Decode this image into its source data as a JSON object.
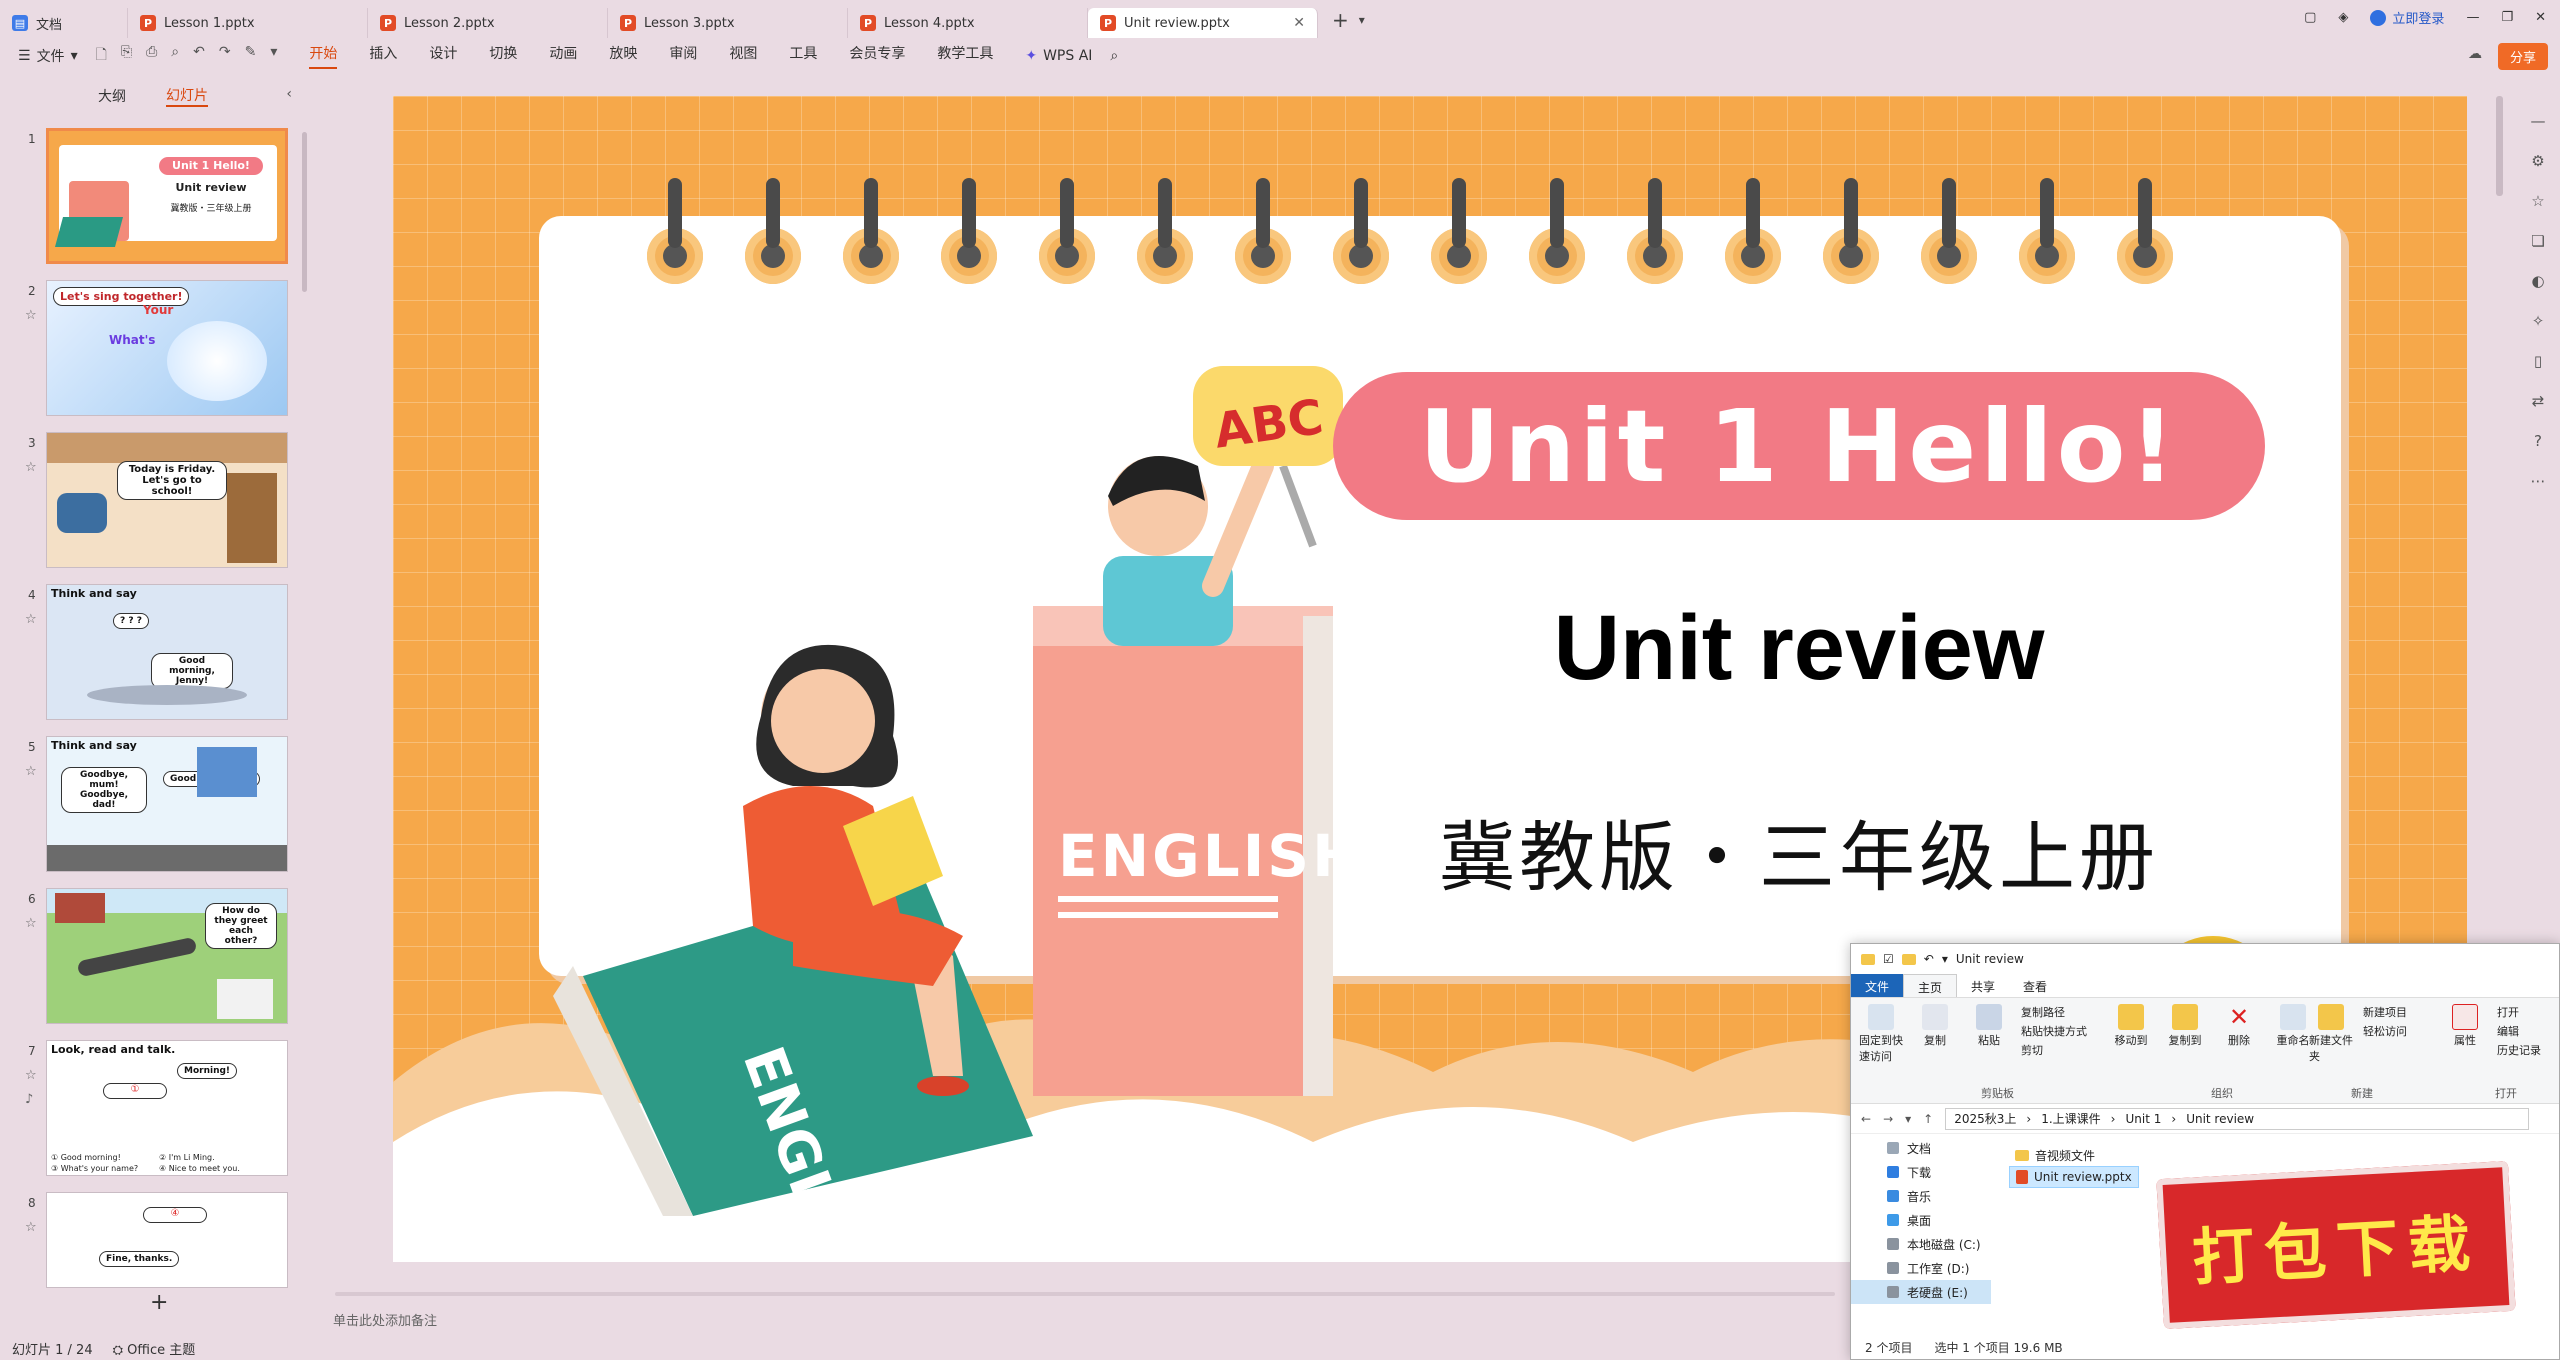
{
  "tabs": [
    {
      "label": "文档",
      "icon": "doc-icon",
      "kind": "d"
    },
    {
      "label": "Lesson 1.pptx",
      "icon": "ppt-icon",
      "kind": "p"
    },
    {
      "label": "Lesson 2.pptx",
      "icon": "ppt-icon",
      "kind": "p"
    },
    {
      "label": "Lesson 3.pptx",
      "icon": "ppt-icon",
      "kind": "p"
    },
    {
      "label": "Lesson 4.pptx",
      "icon": "ppt-icon",
      "kind": "p"
    },
    {
      "label": "Unit review.pptx",
      "icon": "ppt-icon",
      "kind": "p",
      "active": true
    }
  ],
  "topright": {
    "login": "立即登录"
  },
  "ribbon": {
    "file": "文件",
    "menu": [
      "开始",
      "插入",
      "设计",
      "切换",
      "动画",
      "放映",
      "审阅",
      "视图",
      "工具",
      "会员专享",
      "教学工具"
    ],
    "active": "开始",
    "wps_ai": "WPS AI",
    "share": "分享"
  },
  "leftpanel": {
    "tabs": [
      "大纲",
      "幻灯片"
    ],
    "active": "幻灯片",
    "slides": [
      {
        "num": "1",
        "title": "Unit 1 Hello!",
        "sub": "Unit review",
        "pub": "冀教版・三年级上册"
      },
      {
        "num": "2",
        "caption": "Let's sing together!",
        "words": [
          "Your",
          "What's"
        ]
      },
      {
        "num": "3",
        "caption": "Today is Friday. Let's go to school!"
      },
      {
        "num": "4",
        "header": "Think and say",
        "caption": "Good morning, Jenny!",
        "q": "? ? ?"
      },
      {
        "num": "5",
        "header": "Think and say",
        "caption": "Goodbye, mum! Goodbye, dad!",
        "caption2": "Goodbye, Jenny!"
      },
      {
        "num": "6",
        "caption": "How do they greet each other?"
      },
      {
        "num": "7",
        "header": "Look, read and talk.",
        "caption": "Morning!",
        "list": [
          "① Good morning!",
          "② I'm Li Ming.",
          "③ What's your name?",
          "④ Nice to meet you."
        ]
      },
      {
        "num": "8",
        "caption": "Fine, thanks."
      }
    ]
  },
  "slide": {
    "title": "Unit 1 Hello!",
    "subtitle": "Unit review",
    "publisher": "冀教版・三年级上册",
    "book_label": "ENGLISH",
    "book_label2": "ENGLISH",
    "sign": "ABC",
    "colors": {
      "bg": "#f6a84a",
      "pill": "#f27a85",
      "card": "#ffffff"
    }
  },
  "notes_placeholder": "单击此处添加备注",
  "status": {
    "slide": "幻灯片 1 / 24",
    "theme": "Office 主题"
  },
  "explorer": {
    "title": "Unit review",
    "tabs": [
      "文件",
      "主页",
      "共享",
      "查看"
    ],
    "groups": {
      "clipboard": {
        "label": "剪贴板",
        "items": [
          "固定到快速访问",
          "复制",
          "粘贴",
          "复制路径",
          "粘贴快捷方式",
          "剪切"
        ]
      },
      "organize": {
        "label": "组织",
        "items": [
          "移动到",
          "复制到",
          "删除",
          "重命名"
        ]
      },
      "new": {
        "label": "新建",
        "items": [
          "新建文件夹",
          "新建项目",
          "轻松访问"
        ]
      },
      "open": {
        "label": "打开",
        "items": [
          "属性",
          "打开",
          "编辑",
          "历史记录"
        ]
      }
    },
    "path": [
      "2025秋3上",
      "1.上课课件",
      "Unit 1",
      "Unit review"
    ],
    "nav": [
      "文档",
      "下载",
      "音乐",
      "桌面",
      "本地磁盘 (C:)",
      "工作室 (D:)",
      "老硬盘 (E:)"
    ],
    "nav_selected": "老硬盘 (E:)",
    "files": [
      "音视频文件",
      "Unit review.pptx"
    ],
    "status": [
      "2 个项目",
      "选中 1 个项目  19.6 MB"
    ]
  },
  "download_badge": "打包下载"
}
